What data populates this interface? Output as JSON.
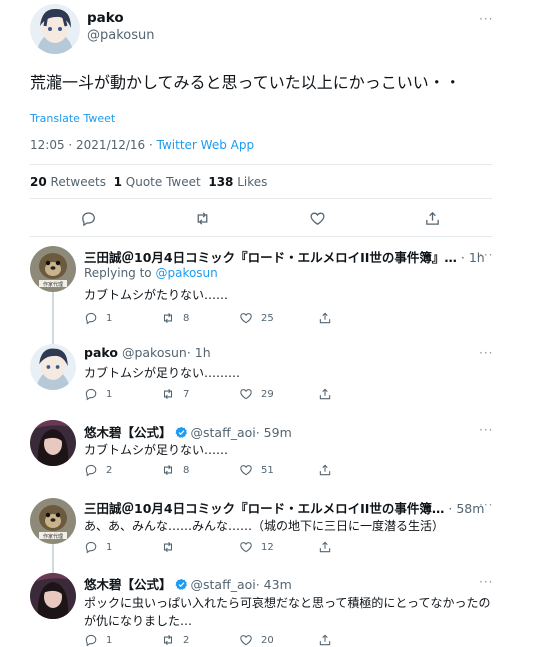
{
  "main_tweet": {
    "name": "pako",
    "handle": "@pakosun",
    "text": "荒瀧一斗が動かしてみると思っていた以上にかっこいい・・",
    "translate": "Translate Tweet",
    "time": "12:05 · 2021/12/16 · ",
    "via": "Twitter Web App",
    "retweets_num": "20",
    "retweets_label": " Retweets",
    "quotes_num": "1",
    "quotes_label": " Quote Tweet",
    "likes_num": "138",
    "likes_label": " Likes"
  },
  "replies": [
    {
      "name": "三田誠＠10月4日コミック『ロード・エルメロイII世の事件簿』…",
      "handle": "",
      "time": "· 1h",
      "replying_prefix": "Replying to ",
      "replying_handle": "@pakosun",
      "text": "カブトムシがたりない……",
      "reply_count": "1",
      "retweet_count": "8",
      "like_count": "25"
    },
    {
      "name": "pako",
      "handle": "@pakosun",
      "time": "· 1h",
      "text": "カブトムシが足りない………",
      "reply_count": "1",
      "retweet_count": "7",
      "like_count": "29"
    },
    {
      "name": "悠木碧【公式】",
      "handle": "@staff_aoi",
      "time": "· 59m",
      "text": "カブトムシが足りない……",
      "reply_count": "2",
      "retweet_count": "8",
      "like_count": "51"
    },
    {
      "name": "三田誠＠10月4日コミック『ロード・エルメロイII世の事件簿…",
      "handle": "",
      "time": "· 58m",
      "text": "あ、あ、みんな……みんな……（城の地下に三日に一度潜る生活）",
      "reply_count": "1",
      "retweet_count": "",
      "like_count": "12"
    },
    {
      "name": "悠木碧【公式】",
      "handle": "@staff_aoi",
      "time": "· 43m",
      "text_line1": "ポックに虫いっぱい入れたら可哀想だなと思って積極的にとってなかったの",
      "text_line2": "が仇になりました…",
      "reply_count": "1",
      "retweet_count": "2",
      "like_count": "20"
    }
  ],
  "more_glyph": "···",
  "colors": {
    "link": "#1d9bf0",
    "muted": "#536471",
    "divider": "#e6e9ec"
  },
  "icons": [
    "reply-icon",
    "retweet-icon",
    "like-icon",
    "share-icon",
    "verified-icon",
    "more-icon"
  ]
}
